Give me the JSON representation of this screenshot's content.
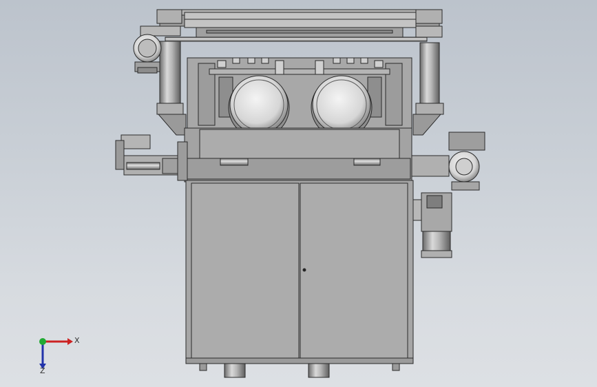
{
  "viewport": {
    "background_top": "#bcc3cc",
    "background_bottom": "#dde0e4"
  },
  "model": {
    "name": "machine-front-view",
    "body_color": "#a6a6a6",
    "edge_color": "#2a2a2a"
  },
  "triad": {
    "x_label": "X",
    "z_label": "Z",
    "x_color": "#cc2222",
    "z_color": "#2233aa",
    "y_color": "#22aa33"
  }
}
